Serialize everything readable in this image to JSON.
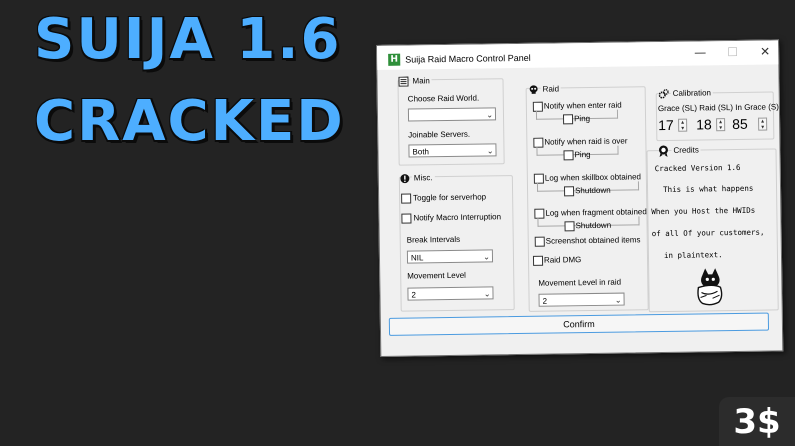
{
  "headline": {
    "line1": "SUIJA 1.6",
    "line2": "CRACKED"
  },
  "price_badge": "3$",
  "window": {
    "title": "Suija Raid Macro Control Panel",
    "icon_letter": "H",
    "minimize": "—",
    "maximize": "☐",
    "close": "✕"
  },
  "main": {
    "title": "Main",
    "choose_world_label": "Choose Raid World.",
    "choose_world_value": "",
    "joinable_label": "Joinable Servers.",
    "joinable_value": "Both"
  },
  "misc": {
    "title": "Misc.",
    "toggle_serverhop": "Toggle for serverhop",
    "notify_interruption": "Notify Macro Interruption",
    "break_label": "Break Intervals",
    "break_value": "NIL",
    "movement_label": "Movement Level",
    "movement_value": "2"
  },
  "raid": {
    "title": "Raid",
    "notify_enter": "Notify when enter raid",
    "ping1": "Ping",
    "notify_over": "Notify when raid is over",
    "ping2": "Ping",
    "log_skillbox": "Log when skillbox obtained",
    "shutdown1": "Shutdown",
    "log_fragment": "Log when fragment obtained",
    "shutdown2": "Shutdown",
    "screenshot_items": "Screenshot obtained items",
    "raid_dmg": "Raid DMG",
    "movement_label": "Movement Level in raid",
    "movement_value": "2"
  },
  "calibration": {
    "title": "Calibration",
    "header": "Grace (SL) Raid (SL) In Grace (S)",
    "grace_value": "17",
    "raid_value": "18",
    "in_grace_value": "85"
  },
  "credits": {
    "title": "Credits",
    "lines": [
      "Cracked Version 1.6",
      "This is what happens",
      "When you Host the HWIDs",
      "of all Of your customers,",
      "in plaintext."
    ]
  },
  "confirm_label": "Confirm",
  "colors": {
    "background": "#232323",
    "headline": "#4daeff",
    "accent_border": "#4b9be0"
  }
}
